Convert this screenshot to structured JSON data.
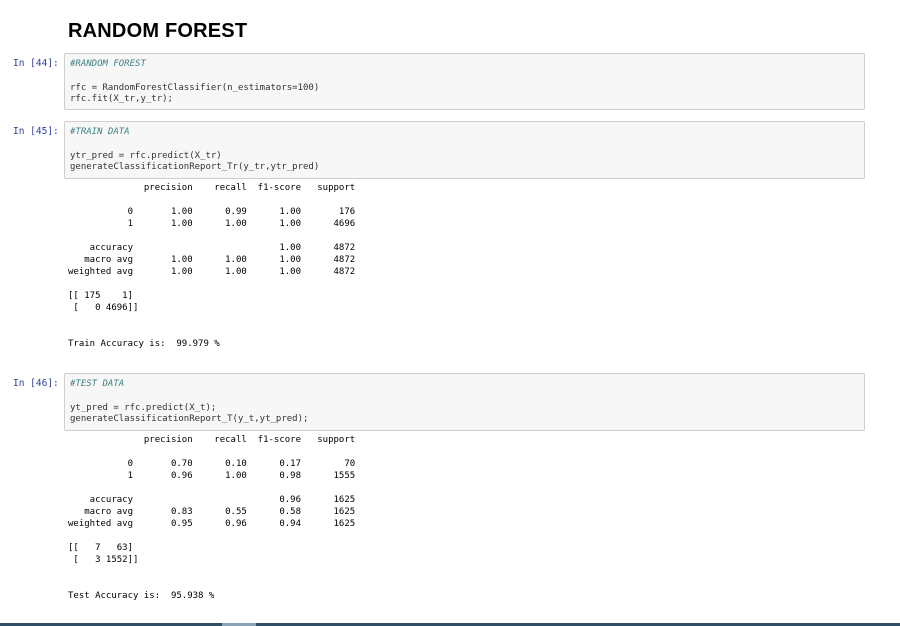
{
  "heading": "RANDOM FOREST",
  "cells": [
    {
      "prompt": "In [44]:",
      "comment": "#RANDOM FOREST",
      "code": [
        "rfc = RandomForestClassifier(n_estimators=100)",
        "rfc.fit(X_tr,y_tr);"
      ]
    },
    {
      "prompt": "In [45]:",
      "comment": "#TRAIN DATA",
      "code": [
        "ytr_pred = rfc.predict(X_tr)",
        "generateClassificationReport_Tr(y_tr,ytr_pred)"
      ],
      "report_header": "              precision    recall  f1-score   support",
      "report_rows": [
        "           0       1.00      0.99      1.00       176",
        "           1       1.00      1.00      1.00      4696",
        "",
        "    accuracy                           1.00      4872",
        "   macro avg       1.00      1.00      1.00      4872",
        "weighted avg       1.00      1.00      1.00      4872"
      ],
      "confusion_matrix": [
        "[[ 175    1]",
        " [   0 4696]]"
      ],
      "accuracy_text": "Train Accuracy is:  99.979 %"
    },
    {
      "prompt": "In [46]:",
      "comment": "#TEST DATA",
      "code": [
        "yt_pred = rfc.predict(X_t);",
        "generateClassificationReport_T(y_t,yt_pred);"
      ],
      "report_header": "              precision    recall  f1-score   support",
      "report_rows": [
        "           0       0.70      0.10      0.17        70",
        "           1       0.96      1.00      0.98      1555",
        "",
        "    accuracy                           0.96      1625",
        "   macro avg       0.83      0.55      0.58      1625",
        "weighted avg       0.95      0.96      0.94      1625"
      ],
      "confusion_matrix": [
        "[[   7   63]",
        " [   3 1552]]"
      ],
      "accuracy_text": "Test Accuracy is:  95.938 %"
    }
  ],
  "colors": {
    "prompt": "#303f9f",
    "comment": "#408080",
    "cell_bg": "#f7f7f7",
    "cell_border": "#cfcfcf"
  }
}
